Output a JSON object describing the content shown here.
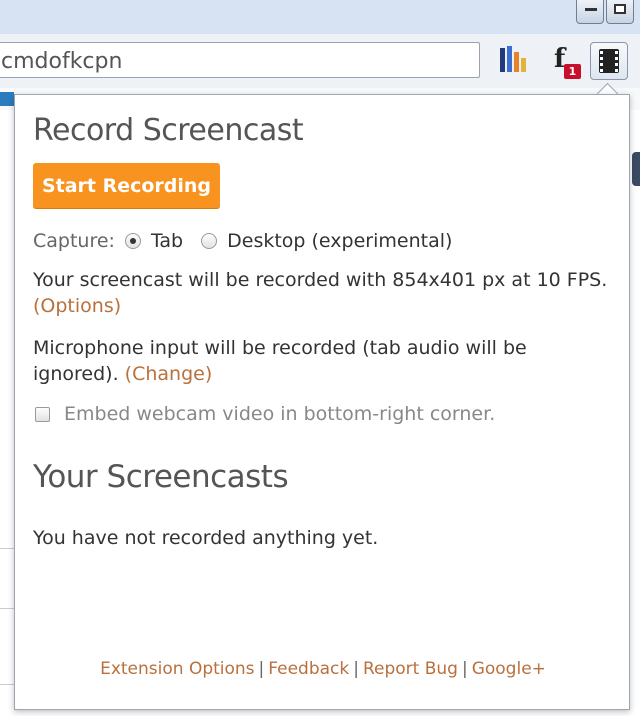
{
  "browser": {
    "omnibox_text": "cmdofkcpn",
    "extension_badge": "1"
  },
  "popup": {
    "title": "Record Screencast",
    "start_button": "Start Recording",
    "capture": {
      "label": "Capture:",
      "options": [
        {
          "label": "Tab",
          "selected": true
        },
        {
          "label": "Desktop (experimental)",
          "selected": false
        }
      ]
    },
    "resolution_text": "Your screencast will be recorded with 854x401 px at 10 FPS.",
    "options_link": "(Options)",
    "microphone_text": "Microphone input will be recorded (tab audio will be ignored).",
    "change_link": "(Change)",
    "webcam_label": "Embed webcam video in bottom-right corner.",
    "webcam_checked": false,
    "screencasts_title": "Your Screencasts",
    "empty_text": "You have not recorded anything yet.",
    "footer_links": [
      "Extension Options",
      "Feedback",
      "Report Bug",
      "Google+"
    ],
    "footer_separator": "|"
  },
  "colors": {
    "accent": "#f7931e",
    "link": "#b9703c"
  }
}
